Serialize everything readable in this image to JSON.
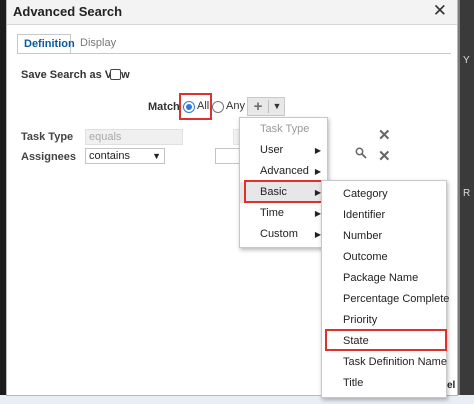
{
  "dialog": {
    "title": "Advanced Search",
    "close_glyph": "✕"
  },
  "tabs": [
    {
      "label": "Definition",
      "active": true
    },
    {
      "label": "Display",
      "active": false
    }
  ],
  "save_search": {
    "label": "Save Search as View",
    "checked": false
  },
  "match": {
    "label": "Match",
    "options": [
      {
        "label": "All",
        "selected": true
      },
      {
        "label": "Any",
        "selected": false
      }
    ]
  },
  "add_button": {
    "plus_icon": "plus-icon",
    "caret_icon": "caret-down-icon"
  },
  "criteria": [
    {
      "label": "Task Type",
      "operator": "equals",
      "enabled": false
    },
    {
      "label": "Assignees",
      "operator": "contains",
      "enabled": true
    }
  ],
  "menu_level1": {
    "header": "Task Type",
    "items": [
      {
        "label": "User",
        "has_submenu": true
      },
      {
        "label": "Advanced",
        "has_submenu": true
      },
      {
        "label": "Basic",
        "has_submenu": true,
        "selected": true
      },
      {
        "label": "Time",
        "has_submenu": true
      },
      {
        "label": "Custom",
        "has_submenu": true
      }
    ]
  },
  "menu_level2": {
    "items": [
      "Category",
      "Identifier",
      "Number",
      "Outcome",
      "Package Name",
      "Percentage Complete",
      "Priority",
      "State",
      "Task Definition Name",
      "Title"
    ],
    "highlighted": "State"
  },
  "background": {
    "peek_top": "Y",
    "peek_mid": "R",
    "peek_bottom": "el",
    "accent": "#e0302b",
    "link_blue": "#0a5aa5"
  }
}
